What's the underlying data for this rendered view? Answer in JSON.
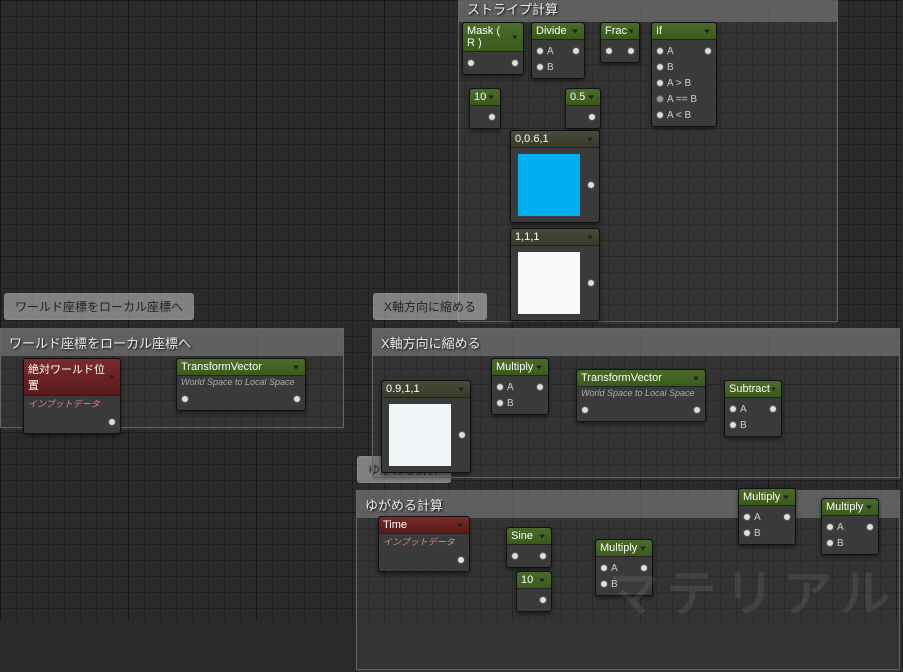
{
  "watermark": "マテリアル",
  "hints": {
    "world_to_local": "ワールド座標をローカル座標へ",
    "shrink_x": "X軸方向に縮める",
    "distort": "ゆがめる計算"
  },
  "comments": {
    "stripe": "ストライプ計算",
    "world_to_local": "ワールド座標をローカル座標へ",
    "shrink_x": "X軸方向に縮める",
    "distort": "ゆがめる計算"
  },
  "nodes": {
    "mask": {
      "title": "Mask ( R )"
    },
    "divide": {
      "title": "Divide",
      "pins": {
        "a": "A",
        "b": "B"
      }
    },
    "frac": {
      "title": "Frac"
    },
    "if": {
      "title": "If",
      "pins": {
        "a": "A",
        "b": "B",
        "agtb": "A > B",
        "aeqb": "A == B",
        "altb": "A < B"
      }
    },
    "const10a": {
      "title": "10"
    },
    "const05": {
      "title": "0.5"
    },
    "color_cyan": {
      "title": "0,0.6,1"
    },
    "color_white": {
      "title": "1,1,1"
    },
    "abs_world": {
      "title": "絶対ワールド位置",
      "sub": "インプットデータ"
    },
    "xform1": {
      "title": "TransformVector",
      "sub": "World Space to Local Space"
    },
    "color_09": {
      "title": "0.9,1,1"
    },
    "multiply1": {
      "title": "Multiply",
      "pins": {
        "a": "A",
        "b": "B"
      }
    },
    "xform2": {
      "title": "TransformVector",
      "sub": "World Space to Local Space"
    },
    "subtract": {
      "title": "Subtract",
      "pins": {
        "a": "A",
        "b": "B"
      }
    },
    "time": {
      "title": "Time",
      "sub": "インプットデータ"
    },
    "sine": {
      "title": "Sine"
    },
    "const10b": {
      "title": "10"
    },
    "multiply2": {
      "title": "Multiply",
      "pins": {
        "a": "A",
        "b": "B"
      }
    },
    "multiply3": {
      "title": "Multiply",
      "pins": {
        "a": "A",
        "b": "B"
      }
    },
    "multiply4": {
      "title": "Multiply",
      "pins": {
        "a": "A",
        "b": "B"
      }
    }
  },
  "colors": {
    "cyan": "#00b0f0",
    "white": "#f8f8f8",
    "pale": "#f0f5f8"
  }
}
